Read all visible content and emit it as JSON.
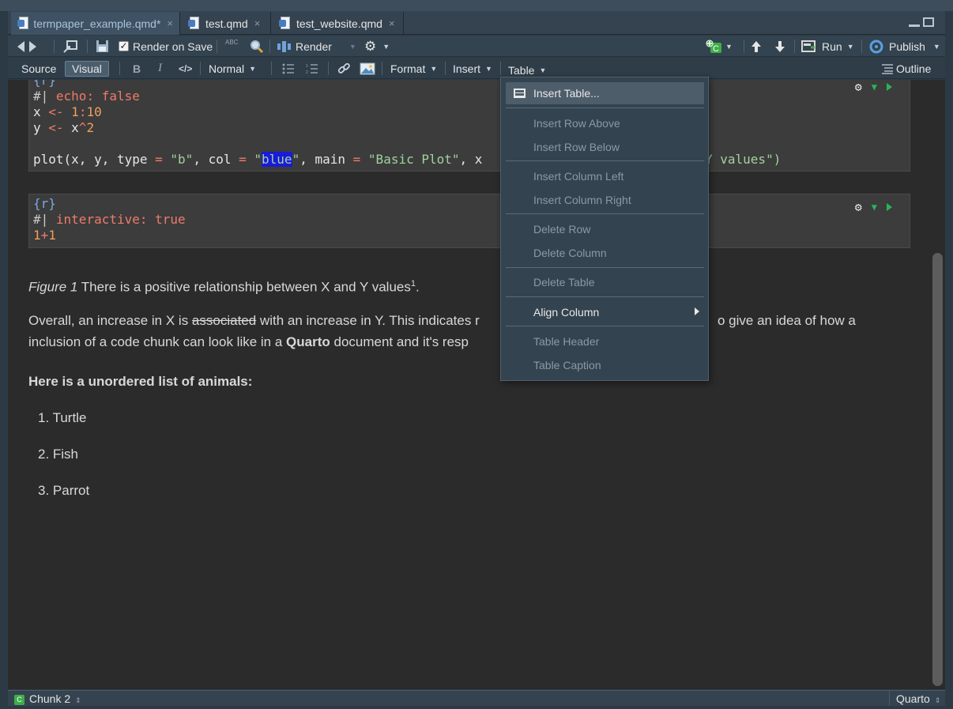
{
  "tabs": [
    {
      "label": "termpaper_example.qmd*",
      "close": "×"
    },
    {
      "label": "test.qmd",
      "close": "×"
    },
    {
      "label": "test_website.qmd",
      "close": "×"
    }
  ],
  "toolbar1": {
    "render_on_save": "Render on Save",
    "render": "Render",
    "run": "Run",
    "publish": "Publish",
    "spell": "ABC"
  },
  "toolbar2": {
    "source": "Source",
    "visual": "Visual",
    "bold": "B",
    "italic": "I",
    "code": "</>",
    "style": "Normal",
    "format": "Format",
    "insert": "Insert",
    "table": "Table",
    "outline": "Outline"
  },
  "chunk1": {
    "l0": "{r}",
    "l1_com": "#| ",
    "l1_key": "echo",
    "l1_sep": ": ",
    "l1_val": "false",
    "l2a": "x ",
    "l2op": "<-",
    "l2b": " ",
    "l2num1": "1",
    "l2c": ":",
    "l2num2": "10",
    "l3a": "y ",
    "l3op": "<-",
    "l3b": " x",
    "l3op2": "^",
    "l3num": "2",
    "l5a": "plot(x, y, type ",
    "l5eq1": "=",
    "l5b": " ",
    "l5s1": "\"b\"",
    "l5c": ", col ",
    "l5eq2": "=",
    "l5d": " ",
    "l5q1": "\"",
    "l5sel": "blue",
    "l5q2": "\"",
    "l5e": ", main ",
    "l5eq3": "=",
    "l5f": " ",
    "l5s2": "\"Basic Plot\"",
    "l5g": ", x",
    "l5tail": "Y values\")"
  },
  "chunk2": {
    "l0": "{r}",
    "l1_com": "#| ",
    "l1_key": "interactive",
    "l1_sep": ": ",
    "l1_val": "true",
    "l2num1": "1",
    "l2op": "+",
    "l2num2": "1"
  },
  "prose": {
    "fig_label": "Figure 1",
    "fig_text": " There is a positive relationship between X and Y values",
    "fig_sup": "1",
    "fig_end": ".",
    "para_a": "Overall, an increase in X is ",
    "para_strike": "associated",
    "para_b": " with an increase in Y. This indicates r",
    "para_tail": "o give an idea of how a",
    "para2_a": "inclusion of a code chunk can look like in a ",
    "para2_bold": "Quarto",
    "para2_b": " document and it's resp",
    "list_heading": "Here is a unordered list of animals:",
    "items": [
      "1. Turtle",
      "2. Fish",
      "3. Parrot"
    ]
  },
  "status": {
    "chunk": "Chunk 2",
    "badge": "C",
    "mode": "Quarto"
  },
  "table_menu": {
    "insert_table": "Insert Table...",
    "insert_row_above": "Insert Row Above",
    "insert_row_below": "Insert Row Below",
    "insert_col_left": "Insert Column Left",
    "insert_col_right": "Insert Column Right",
    "delete_row": "Delete Row",
    "delete_column": "Delete Column",
    "delete_table": "Delete Table",
    "align_column": "Align Column",
    "table_header": "Table Header",
    "table_caption": "Table Caption"
  }
}
